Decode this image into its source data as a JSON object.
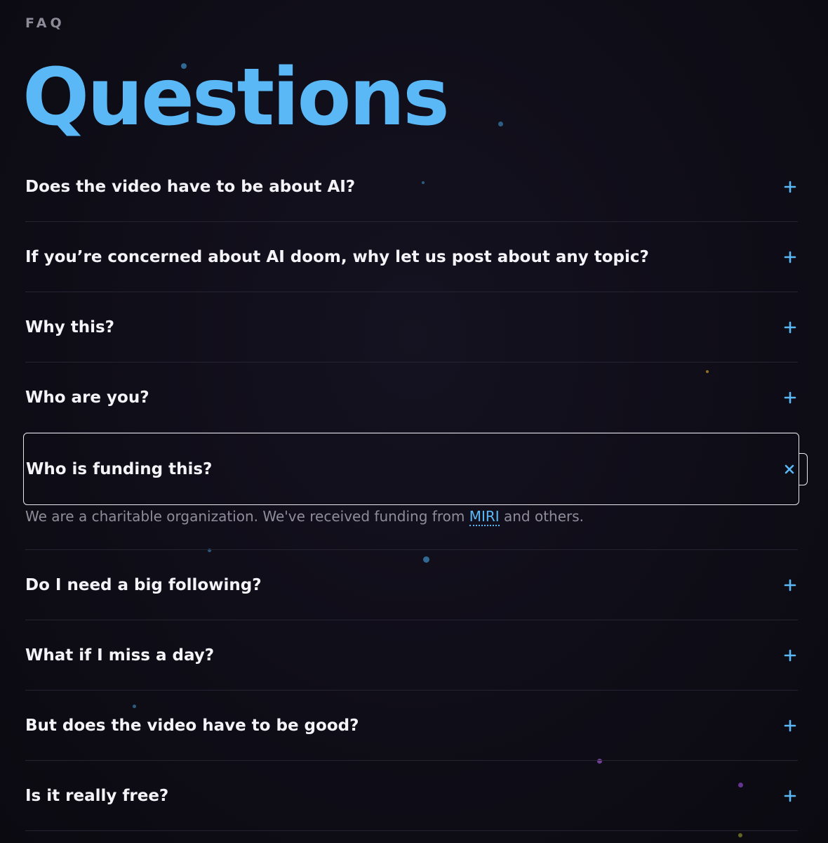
{
  "header": {
    "eyebrow": "FAQ",
    "title": "Questions"
  },
  "colors": {
    "accent": "#5ab8f6",
    "background": "#0f0d17",
    "divider": "#262433",
    "answer_text": "#8f8d99"
  },
  "icons": {
    "collapsed": "plus-icon",
    "expanded": "close-icon"
  },
  "faq": [
    {
      "question": "Does the video have to be about AI?",
      "open": false
    },
    {
      "question": "If you’re concerned about AI doom, why let us post about any topic?",
      "open": false
    },
    {
      "question": "Why this?",
      "open": false
    },
    {
      "question": "Who are you?",
      "open": false
    },
    {
      "question": "Who is funding this?",
      "open": true,
      "answer_before": "We are a charitable organization. We've received funding from ",
      "answer_link": "MIRI",
      "answer_after": " and others."
    },
    {
      "question": "Do I need a big following?",
      "open": false
    },
    {
      "question": "What if I miss a day?",
      "open": false
    },
    {
      "question": "But does the video have to be good?",
      "open": false
    },
    {
      "question": "Is it really free?",
      "open": false
    }
  ]
}
